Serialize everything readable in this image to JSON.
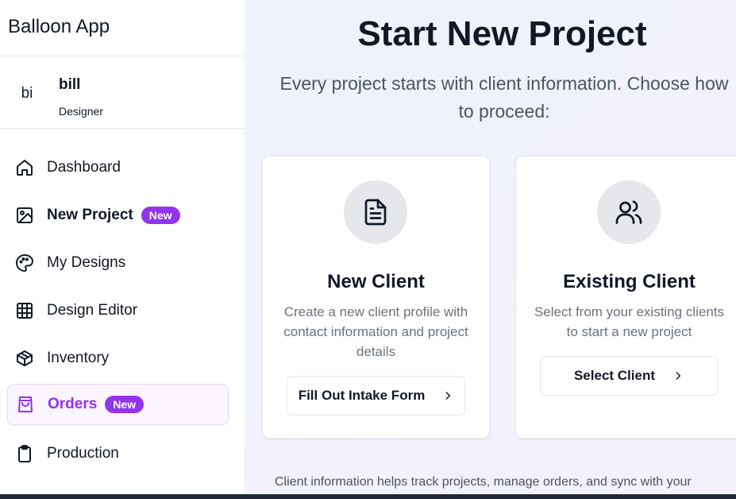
{
  "app": {
    "title": "Balloon App"
  },
  "user": {
    "initials": "bi",
    "name": "bill",
    "role": "Designer"
  },
  "sidebar": {
    "items": [
      {
        "label": "Dashboard",
        "icon": "home-icon"
      },
      {
        "label": "New Project",
        "icon": "image-icon",
        "badge": "New"
      },
      {
        "label": "My Designs",
        "icon": "palette-icon"
      },
      {
        "label": "Design Editor",
        "icon": "grid-icon"
      },
      {
        "label": "Inventory",
        "icon": "box-icon"
      },
      {
        "label": "Orders",
        "icon": "shopping-bag-icon",
        "badge": "New",
        "active": true
      },
      {
        "label": "Production",
        "icon": "clipboard-icon"
      }
    ]
  },
  "main": {
    "title": "Start New Project",
    "subtitle": "Every project starts with client information. Choose how to proceed:",
    "cards": [
      {
        "icon": "document-icon",
        "title": "New Client",
        "description": "Create a new client profile with contact information and project details",
        "button": "Fill Out Intake Form"
      },
      {
        "icon": "users-icon",
        "title": "Existing Client",
        "description": "Select from your existing clients to start a new project",
        "button": "Select Client"
      }
    ],
    "footer": "Client information helps track projects, manage orders, and sync with your"
  },
  "colors": {
    "accent": "#9333ea",
    "active_bg": "#fbf5ff",
    "active_border": "#e9d5ff"
  }
}
